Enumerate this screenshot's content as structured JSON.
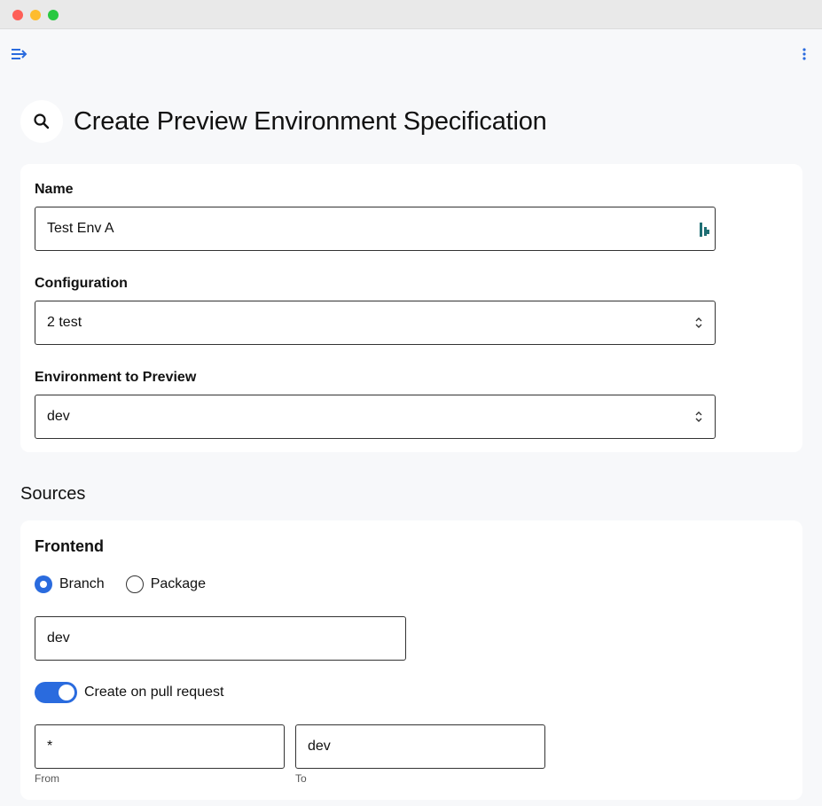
{
  "window": {
    "controls": [
      "close",
      "minimize",
      "zoom"
    ]
  },
  "topbar": {
    "menu_icon": "menu-collapse-icon",
    "more_icon": "more-vert-icon"
  },
  "page": {
    "title": "Create Preview Environment Specification",
    "title_icon": "search-icon"
  },
  "spec": {
    "name": {
      "label": "Name",
      "value": "Test Env A"
    },
    "configuration": {
      "label": "Configuration",
      "value": "2 test"
    },
    "environment": {
      "label": "Environment to Preview",
      "value": "dev"
    }
  },
  "sources": {
    "title": "Sources",
    "frontend": {
      "title": "Frontend",
      "radio_options": [
        {
          "label": "Branch",
          "checked": true
        },
        {
          "label": "Package",
          "checked": false
        }
      ],
      "branch_value": "dev",
      "toggle": {
        "label": "Create on pull request",
        "on": true
      },
      "from": {
        "value": "*",
        "helper": "From"
      },
      "to": {
        "value": "dev",
        "helper": "To"
      }
    }
  },
  "colors": {
    "accent": "#2a6bde",
    "page_bg": "#f7f8fa",
    "card_bg": "#ffffff"
  }
}
